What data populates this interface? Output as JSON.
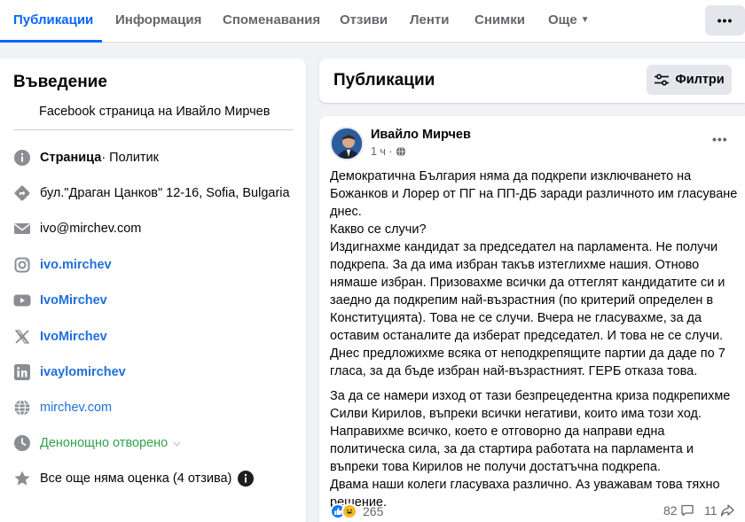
{
  "tabs": [
    {
      "label": "Публикации"
    },
    {
      "label": "Информация"
    },
    {
      "label": "Споменавания"
    },
    {
      "label": "Отзиви"
    },
    {
      "label": "Ленти"
    },
    {
      "label": "Снимки"
    },
    {
      "label": "Още"
    }
  ],
  "more_button_label": "•••",
  "intro": {
    "title": "Въведение",
    "subtitle": "Facebook страница на Ивайло Мирчев",
    "category_bold": "Страница",
    "category_rest": " · Политик",
    "address": "бул.\"Драган Цанков\" 12-16, Sofia, Bulgaria",
    "email": "ivo@mirchev.com",
    "instagram": "ivo.mirchev",
    "youtube": "IvoMirchev",
    "x_handle": "IvoMirchev",
    "linkedin": "ivaylomirchev",
    "website": "mirchev.com",
    "hours": "Денонощно отворено",
    "rating": "Все още няма оценка (4 отзива)"
  },
  "publications": {
    "title": "Публикации",
    "filter_label": "Филтри"
  },
  "post": {
    "author": "Ивайло Мирчев",
    "time": "1 ч ·",
    "dots": "•••",
    "paragraph1": "Демократична България няма да подкрепи изключването на Божанков и Лорер от ПГ на ПП-ДБ заради различното им гласуване днес.\nКакво се случи?\nИздигнахме кандидат за председател на парламента. Не получи подкрепа. За да има избран такъв изтеглихме нашия. Отново нямаше избран. Призовахме всички да оттеглят кандидатите си и заедно да подкрепим най-възрастния (по критерий определен в Конституцията). Това не се случи. Вчера не гласувахме, за да оставим останалите да изберат председател. И това не се случи. Днес предложихме всяка от неподкрепящите партии да даде по 7 гласа, за да бъде избран най-възрастният. ГЕРБ отказа това.",
    "paragraph2": "За да се намери изход от тази безпрецедентна криза подкрепихме Силви Кирилов, въпреки всички негативи, които има този ход. Направихме всичко, което е отговорно да направи една политическа сила, за да стартира работата на парламента и въпреки това Кирилов не получи достатъчна подкрепа.\nДвама наши колеги гласуваха различно. Аз уважавам това тяхно решение.",
    "reactions_count": "265",
    "comments_count": "82",
    "shares_count": "11"
  },
  "colors": {
    "accent": "#0866ff",
    "link": "#216fdb",
    "green": "#31a24c",
    "muted": "#65676b",
    "background": "#f0f2f5"
  }
}
